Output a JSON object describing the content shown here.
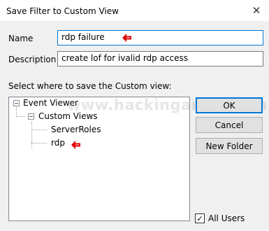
{
  "window": {
    "title": "Save Filter to Custom View",
    "close_symbol": "✕"
  },
  "form": {
    "name_label": "Name",
    "name_value": "rdp failure",
    "description_label": "Description",
    "description_value": "create lof for ivalid rdp access",
    "location_label": "Select where to save the Custom view:"
  },
  "tree": {
    "root": "Event Viewer",
    "custom_views": "Custom Views",
    "server_roles": "ServerRoles",
    "rdp": "rdp",
    "collapse_symbol": "−"
  },
  "watermark": "www.hackingarticles.in",
  "buttons": {
    "ok": "OK",
    "cancel": "Cancel",
    "new_folder": "New Folder"
  },
  "all_users": {
    "label": "All Users",
    "checked": true,
    "check_symbol": "✓"
  },
  "colors": {
    "arrow": "#e00000",
    "focus_border": "#0078d7"
  },
  "icons": [
    "close-icon",
    "red-arrow-icon",
    "minus-expander-icon",
    "checkmark-icon"
  ]
}
